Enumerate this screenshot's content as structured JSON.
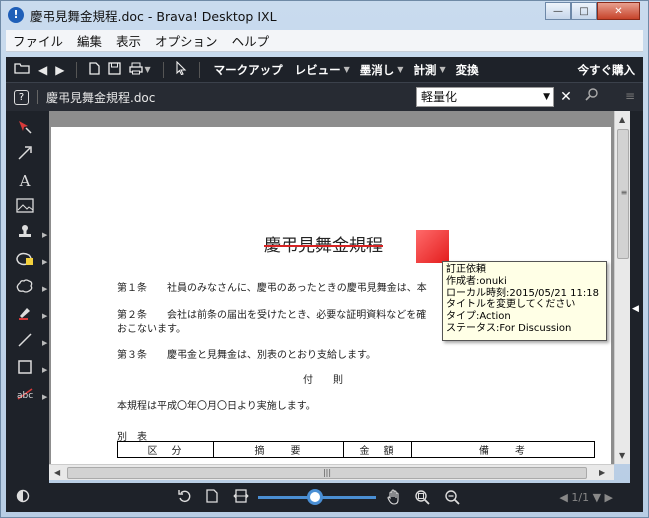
{
  "window": {
    "title": "慶弔見舞金規程.doc - Brava! Desktop IXL",
    "app_icon": "!",
    "minimize_glyph": "—",
    "maximize_glyph": "□",
    "close_glyph": "✕"
  },
  "menu": [
    "ファイル",
    "編集",
    "表示",
    "オプション",
    "ヘルプ"
  ],
  "toolbar": {
    "markup_label": "マークアップ",
    "review_label": "レビュー",
    "erase_label": "墨消し",
    "measure_label": "計測",
    "convert_label": "変換",
    "buy_label": "今すぐ購入"
  },
  "toolbar2": {
    "help_glyph": "?",
    "document_name": "慶弔見舞金規程.doc",
    "search_value": "軽量化",
    "clear_glyph": "✕"
  },
  "document": {
    "title": "慶弔見舞金規程",
    "article1": "第１条　　社員のみなさんに、慶弔のあったときの慶弔見舞金は、本",
    "article2_line1": "第２条　　会社は前条の届出を受けたとき、必要な証明資料などを確",
    "article2_line2": "おこないます。",
    "article3": "第３条　　慶弔金と見舞金は、別表のとおり支給します。",
    "supplementary": "付　　則",
    "effective": "本規程は平成〇年〇月〇日より実施します。",
    "table_caption": "別　表",
    "table_headers": [
      "区　分",
      "摘　　要",
      "金　額",
      "備　　考"
    ]
  },
  "annotation": {
    "lines": [
      "訂正依頼",
      "作成者:onuki",
      "ローカル時刻:2015/05/21 11:18",
      "タイトルを変更してください",
      "タイプ:Action",
      "ステータス:For Discussion"
    ],
    "color": "#e31d1d"
  },
  "pagenav": {
    "label": "1/1"
  },
  "colors": {
    "toolbar_bg": "#1e2229",
    "accent": "#4a8fd4",
    "note_bg": "#ffffe6"
  }
}
